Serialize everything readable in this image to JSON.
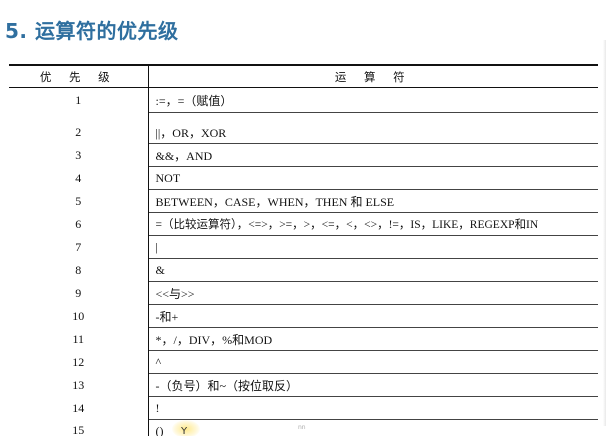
{
  "heading": "5. 运算符的优先级",
  "table": {
    "headers": {
      "level": "优 先 级",
      "operators": "运 算 符"
    },
    "rows": [
      {
        "level": "1",
        "operators": ":=，=（赋值）"
      },
      {
        "level": "2",
        "operators": "||，OR，XOR"
      },
      {
        "level": "3",
        "operators": "&&，AND"
      },
      {
        "level": "4",
        "operators": "NOT"
      },
      {
        "level": "5",
        "operators": "BETWEEN，CASE，WHEN，THEN 和 ELSE"
      },
      {
        "level": "6",
        "operators": "=（比较运算符），<=>，>=，>，<=，<，<>，!=，IS，LIKE，REGEXP和IN"
      },
      {
        "level": "7",
        "operators": "|"
      },
      {
        "level": "8",
        "operators": "&"
      },
      {
        "level": "9",
        "operators": "<<与>>"
      },
      {
        "level": "10",
        "operators": "-和+"
      },
      {
        "level": "11",
        "operators": "*，/，DIV，%和MOD"
      },
      {
        "level": "12",
        "operators": "^"
      },
      {
        "level": "13",
        "operators": "-（负号）和~（按位取反）"
      },
      {
        "level": "14",
        "operators": "!"
      },
      {
        "level": "15",
        "operators": "()"
      }
    ]
  },
  "cursor_char": "Y",
  "tiny_mark": "nn"
}
